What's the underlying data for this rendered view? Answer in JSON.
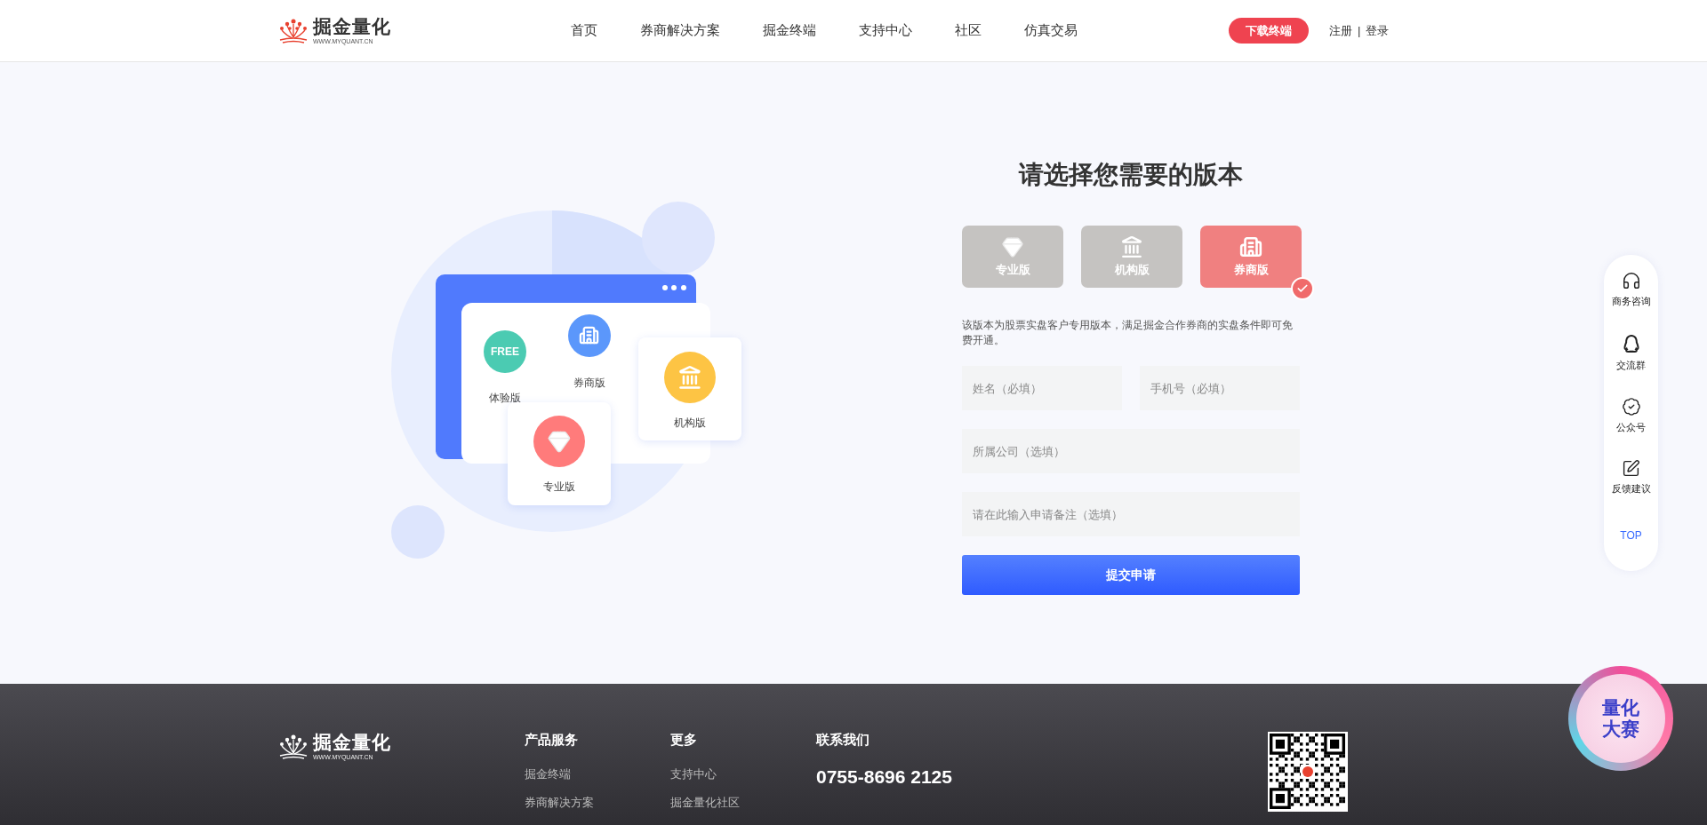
{
  "header": {
    "logo": {
      "name": "掘金量化",
      "url": "WWW.MYQUANT.CN"
    },
    "nav": [
      {
        "label": "首页"
      },
      {
        "label": "券商解决方案"
      },
      {
        "label": "掘金终端"
      },
      {
        "label": "支持中心"
      },
      {
        "label": "社区"
      },
      {
        "label": "仿真交易"
      }
    ],
    "download_button": "下载终端",
    "auth_links": [
      "注册",
      "登录"
    ],
    "separator": "|"
  },
  "illustration": {
    "items": [
      {
        "kind": "free",
        "badge": "FREE",
        "label": "体验版"
      },
      {
        "kind": "broker",
        "label": "券商版"
      },
      {
        "kind": "institution",
        "label": "机构版"
      },
      {
        "kind": "pro",
        "label": "专业版"
      }
    ]
  },
  "form": {
    "title": "请选择您需要的版本",
    "versions": [
      {
        "kind": "pro",
        "label": "专业版",
        "selected": false
      },
      {
        "kind": "institution",
        "label": "机构版",
        "selected": false
      },
      {
        "kind": "broker",
        "label": "券商版",
        "selected": true
      }
    ],
    "description": "该版本为股票实盘客户专用版本，满足掘金合作券商的实盘条件即可免费开通。",
    "fields": [
      {
        "placeholder": "姓名（必填）"
      },
      {
        "placeholder": "手机号（必填）"
      },
      {
        "placeholder": "所属公司（选填）"
      },
      {
        "placeholder": "请在此输入申请备注（选填）"
      }
    ],
    "submit": "提交申请"
  },
  "side_toolbar": [
    {
      "kind": "headset",
      "label": "商务咨询"
    },
    {
      "kind": "penguin",
      "label": "交流群"
    },
    {
      "kind": "badge",
      "label": "公众号"
    },
    {
      "kind": "edit",
      "label": "反馈建议"
    },
    {
      "kind": "top",
      "label": "TOP"
    }
  ],
  "promo_badge": {
    "lines": [
      "量化",
      "大赛"
    ]
  },
  "footer": {
    "logo": {
      "name": "掘金量化",
      "url": "WWW.MYQUANT.CN"
    },
    "columns": [
      {
        "title": "产品服务",
        "links": [
          "掘金终端",
          "券商解决方案"
        ]
      },
      {
        "title": "更多",
        "links": [
          "支持中心",
          "掘金量化社区"
        ]
      }
    ],
    "contact": {
      "title": "联系我们",
      "phone": "0755-8696 2125"
    }
  }
}
